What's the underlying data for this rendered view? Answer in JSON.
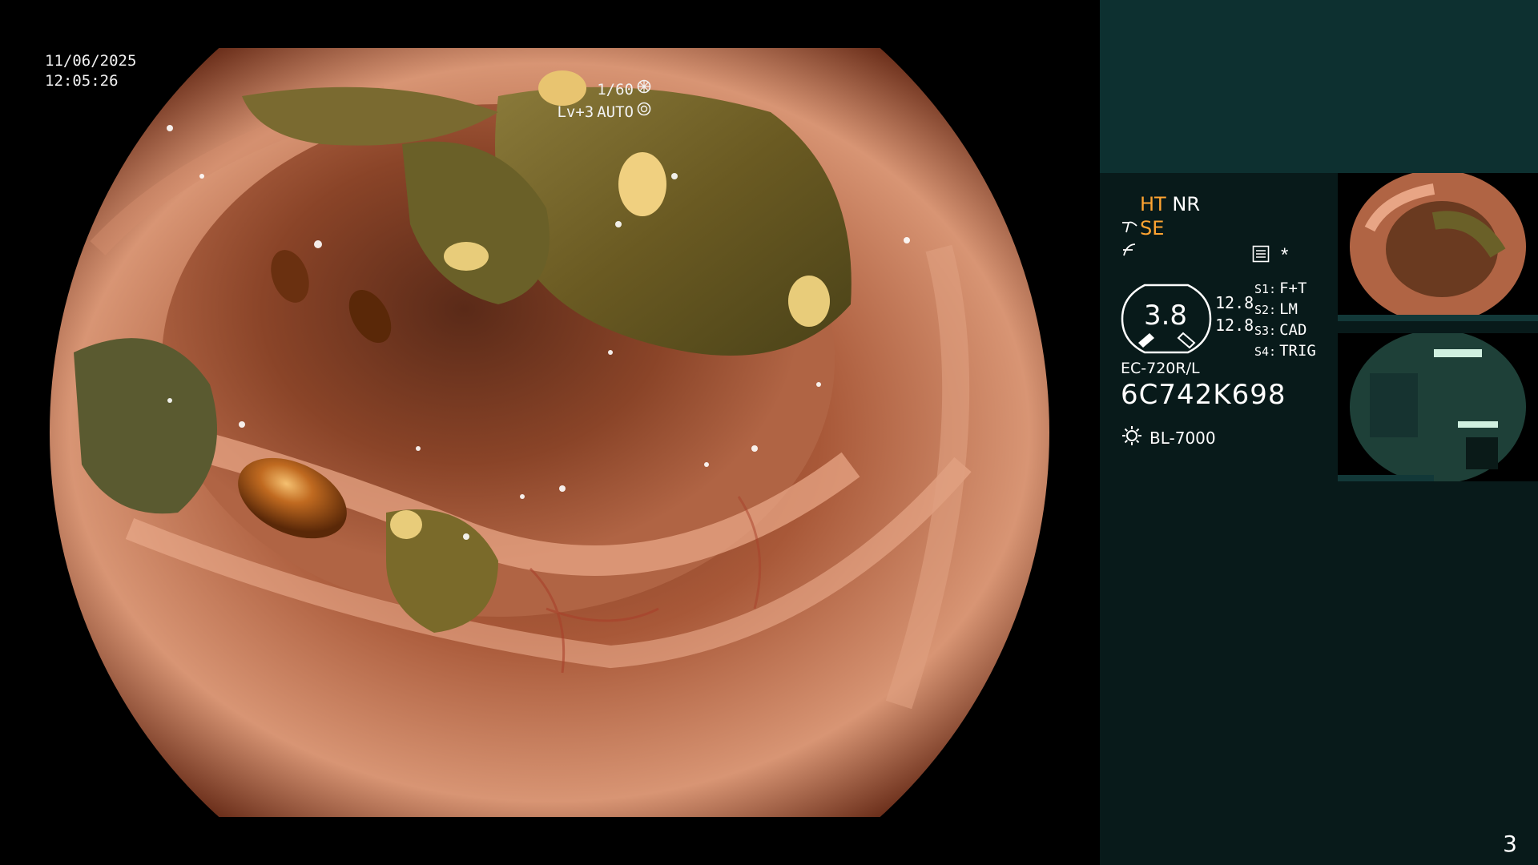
{
  "overlay": {
    "date": "11/06/2025",
    "time": "12:05:26",
    "shutter": "1/60",
    "shutter_icon": "aperture-icon",
    "level": "Lv+3",
    "mode": "AUTO",
    "mode_icon": "auto-iris-icon"
  },
  "panel": {
    "ht": "HT",
    "nr": "NR",
    "se": "SE",
    "se_icon": "structure-enhance-icon",
    "color_icon": "color-enhance-icon",
    "menu_icon": "menu-list-icon",
    "star": "*",
    "gauge_value": "3.8",
    "gauge_sub1": "12.8",
    "gauge_sub2": "12.8",
    "scope_model": "EC-720R/L",
    "serial": "6C742K698",
    "light_icon": "light-source-icon",
    "light_source": "BL-7000",
    "switches": [
      {
        "key": "S1:",
        "value": "F+T"
      },
      {
        "key": "S2:",
        "value": "LM"
      },
      {
        "key": "S3:",
        "value": "CAD"
      },
      {
        "key": "S4:",
        "value": "TRIG"
      }
    ]
  },
  "colors": {
    "accent": "#ffa431",
    "panel_dark": "#031414",
    "panel_top": "#0d3030"
  },
  "page_number": "3"
}
